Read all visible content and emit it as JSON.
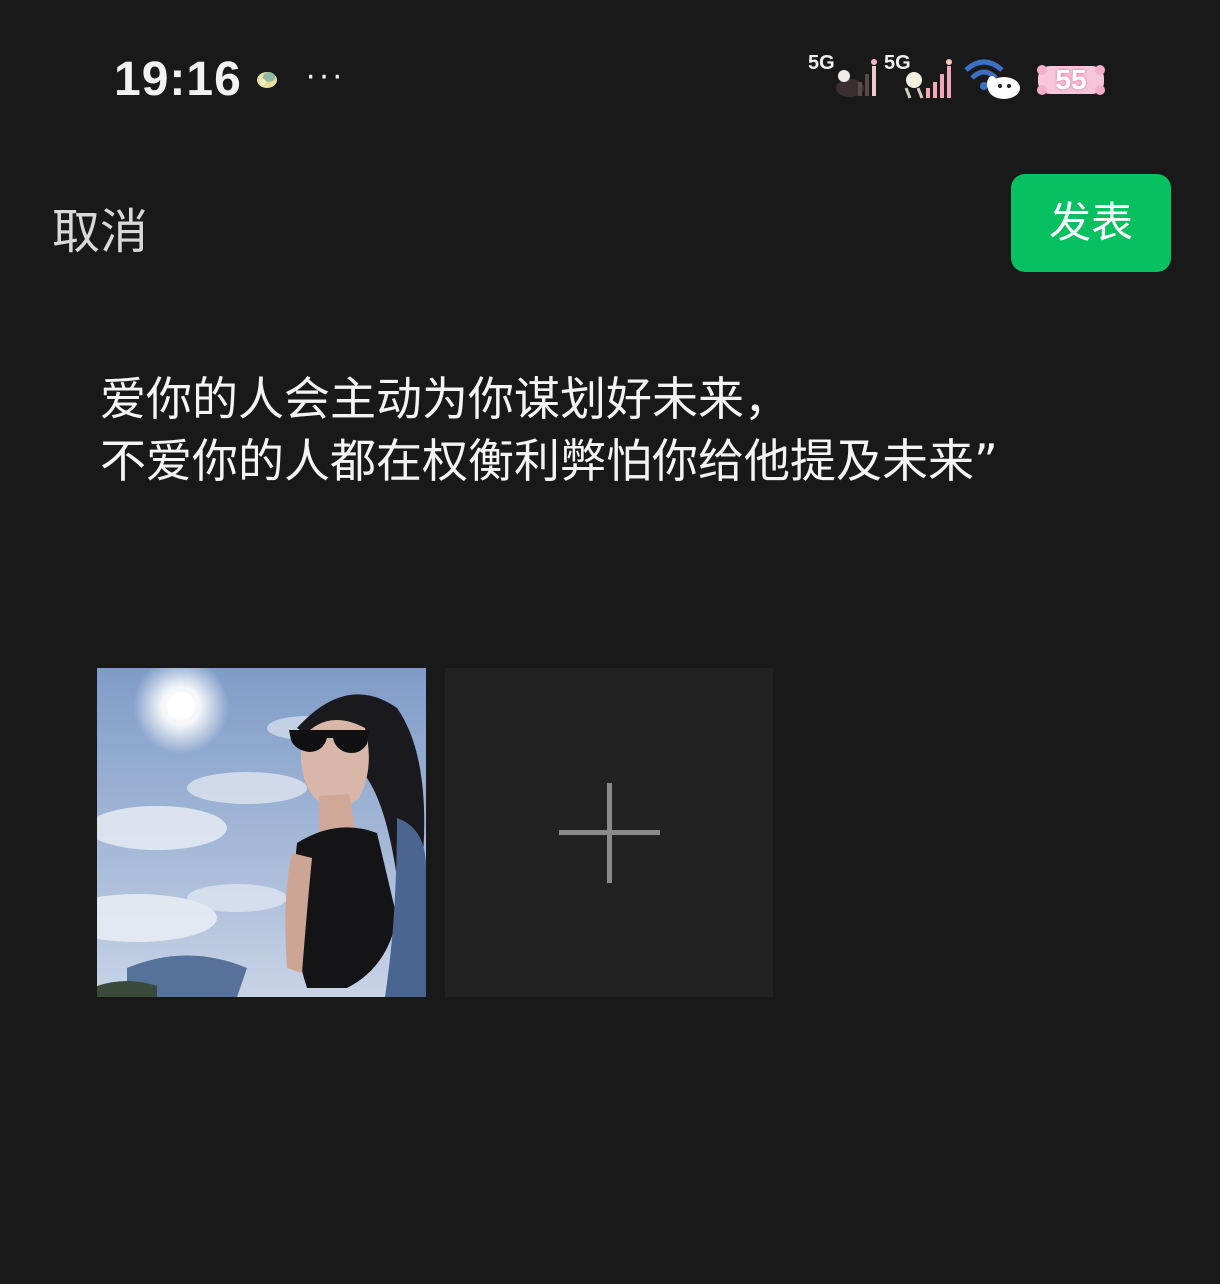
{
  "status_bar": {
    "time": "19:16",
    "more_dots": "···",
    "signal_1": {
      "label": "5G",
      "icon": "signal-icon"
    },
    "signal_2": {
      "label": "5G",
      "icon": "signal-icon"
    },
    "wifi_icon": "wifi-icon",
    "battery": {
      "level": "55",
      "icon": "battery-icon"
    },
    "notification_icon": "app-notification-icon"
  },
  "header": {
    "cancel_label": "取消",
    "publish_label": "发表",
    "accent_color": "#07c160"
  },
  "post": {
    "lines": [
      "爱你的人会主动为你谋划好未来，",
      "不爱你的人都在权衡利弊怕你给他提及未来”"
    ]
  },
  "images": {
    "thumbnails": [
      {
        "icon": "photo-thumbnail"
      }
    ],
    "add_button_icon": "plus-icon"
  }
}
